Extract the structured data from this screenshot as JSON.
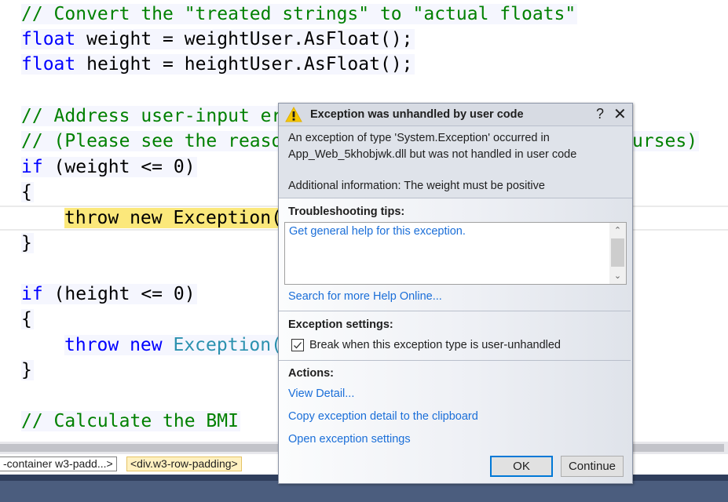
{
  "editor": {
    "lines": [
      {
        "id": "l1",
        "parts": [
          {
            "t": "// Convert the \"treated strings\" to \"actual floats\"",
            "c": "cmt"
          }
        ]
      },
      {
        "id": "l2",
        "parts": [
          {
            "t": "float",
            "c": "kw"
          },
          {
            "t": " weight = weightUser.AsFloat();",
            "c": "txt"
          }
        ]
      },
      {
        "id": "l3",
        "parts": [
          {
            "t": "float",
            "c": "kw"
          },
          {
            "t": " height = heightUser.AsFloat();",
            "c": "txt"
          }
        ]
      },
      {
        "id": "l5",
        "parts": [
          {
            "t": "// Address user-input er",
            "c": "cmt"
          }
        ]
      },
      {
        "id": "l6",
        "parts": [
          {
            "t": "// (Please see the reaso",
            "c": "cmt"
          }
        ]
      },
      {
        "id": "l6b",
        "parts": [
          {
            "t": "urses)",
            "c": "cmt"
          }
        ]
      },
      {
        "id": "l7",
        "parts": [
          {
            "t": "if",
            "c": "kw"
          },
          {
            "t": " (weight <= 0)",
            "c": "txt"
          }
        ]
      },
      {
        "id": "l8",
        "parts": [
          {
            "t": "{",
            "c": "txt"
          }
        ]
      },
      {
        "id": "l9",
        "parts": [
          {
            "t": "throw new Exception(",
            "c": "txt"
          }
        ]
      },
      {
        "id": "l10",
        "parts": [
          {
            "t": "}",
            "c": "txt"
          }
        ]
      },
      {
        "id": "l12",
        "parts": [
          {
            "t": "if",
            "c": "kw"
          },
          {
            "t": " (height <= 0)",
            "c": "txt"
          }
        ]
      },
      {
        "id": "l13",
        "parts": [
          {
            "t": "{",
            "c": "txt"
          }
        ]
      },
      {
        "id": "l14",
        "parts": [
          {
            "t": "throw new ",
            "c": "kw"
          },
          {
            "t": "Exception(",
            "c": "typ"
          }
        ]
      },
      {
        "id": "l15",
        "parts": [
          {
            "t": "}",
            "c": "txt"
          }
        ]
      },
      {
        "id": "l17",
        "parts": [
          {
            "t": "// Calculate the BMI",
            "c": "cmt"
          }
        ]
      }
    ]
  },
  "breadcrumb": {
    "items": [
      "-container w3-padd...>",
      "<div.w3-row-padding>"
    ]
  },
  "dialog": {
    "title": "Exception was unhandled by user code",
    "help_label": "?",
    "close_label": "✕",
    "message_line1": "An exception of type 'System.Exception' occurred in",
    "message_line2": "App_Web_5khobjwk.dll but was not handled in user code",
    "additional_info": "Additional information: The weight must be positive",
    "troubleshooting_title": "Troubleshooting tips:",
    "troubleshooting_link": "Get general help for this exception.",
    "search_link": "Search for more Help Online...",
    "settings_title": "Exception settings:",
    "checkbox_label": "Break when this exception type is user-unhandled",
    "checkbox_checked": true,
    "actions_title": "Actions:",
    "actions": [
      "View Detail...",
      "Copy exception detail to the clipboard",
      "Open exception settings"
    ],
    "ok_label": "OK",
    "continue_label": "Continue"
  },
  "colors": {
    "comment": "#008000",
    "keyword": "#0000ff",
    "type": "#2b91af",
    "current_statement": "#fbe87b",
    "link": "#1a6ed8",
    "statusbar": "#4b5d7e",
    "warning": "#f6c700"
  },
  "icons": {
    "warning": "warning-triangle-icon",
    "checkbox": "checkmark-icon",
    "scroll_up": "chevron-up-icon",
    "scroll_down": "chevron-down-icon"
  }
}
